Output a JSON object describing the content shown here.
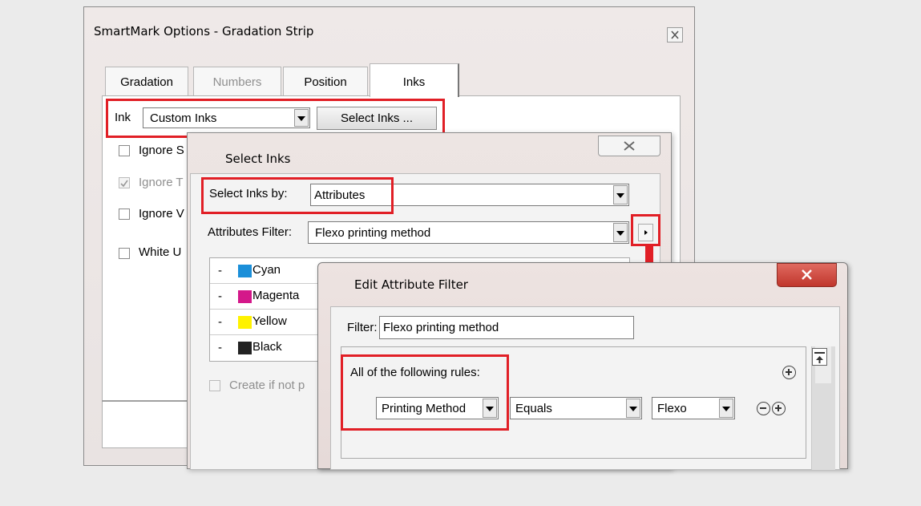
{
  "smartmark": {
    "title": "SmartMark Options - Gradation Strip",
    "tabs": [
      {
        "label": "Gradation"
      },
      {
        "label": "Numbers"
      },
      {
        "label": "Position"
      },
      {
        "label": "Inks"
      }
    ],
    "ink_label": "Ink",
    "ink_value": "Custom Inks",
    "select_inks_button": "Select Inks ...",
    "checkboxes": [
      {
        "label": "Ignore S",
        "checked": false
      },
      {
        "label": "Ignore T",
        "checked": true
      },
      {
        "label": "Ignore V",
        "checked": false
      },
      {
        "label": "White U",
        "checked": false
      }
    ]
  },
  "select_inks": {
    "title": "Select Inks",
    "select_by_label": "Select Inks by:",
    "select_by_value": "Attributes",
    "filter_label": "Attributes Filter:",
    "filter_value": "Flexo printing method",
    "inks": [
      {
        "name": "Cyan",
        "color": "#1b8fd9"
      },
      {
        "name": "Magenta",
        "color": "#d4188a"
      },
      {
        "name": "Yellow",
        "color": "#fff200"
      },
      {
        "name": "Black",
        "color": "#222222"
      }
    ],
    "create_label": "Create if not p"
  },
  "edit_filter": {
    "title": "Edit Attribute Filter",
    "filter_label": "Filter:",
    "filter_value": "Flexo printing method",
    "rules_label": "All of the following rules:",
    "rule": {
      "attribute": "Printing Method",
      "operator": "Equals",
      "value": "Flexo"
    }
  },
  "colors": {
    "highlight": "#e11f26",
    "close_red": "#c9423a"
  }
}
